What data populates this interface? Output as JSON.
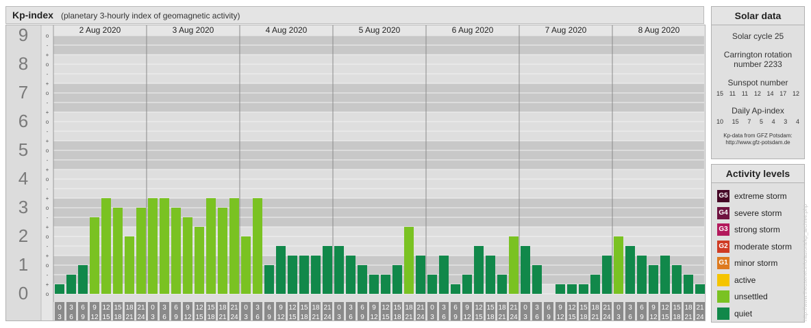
{
  "header": {
    "title": "Kp-index",
    "subtitle": "(planetary 3-hourly index of geomagnetic activity)"
  },
  "colors": {
    "quiet": "#11884a",
    "unsettled": "#7ac222",
    "active": "#f5c400",
    "minor_storm": "#de7a1f",
    "moderate_storm": "#cf3b24",
    "strong_storm": "#b3195c",
    "severe_storm": "#6f1240",
    "extreme_storm": "#450626"
  },
  "chart_data": {
    "type": "bar",
    "title": "Kp-index",
    "ylim": [
      0,
      9
    ],
    "y_ticks": [
      "0",
      "1",
      "2",
      "3",
      "4",
      "5",
      "6",
      "7",
      "8",
      "9"
    ],
    "sub_ticks": [
      "o",
      "+",
      "-"
    ],
    "days": [
      "2 Aug 2020",
      "3 Aug 2020",
      "4 Aug 2020",
      "5 Aug 2020",
      "6 Aug 2020",
      "7 Aug 2020",
      "8 Aug 2020"
    ],
    "interval_starts": [
      "0",
      "3",
      "6",
      "9",
      "12",
      "15",
      "18",
      "21"
    ],
    "interval_ends": [
      "3",
      "6",
      "9",
      "12",
      "15",
      "18",
      "21",
      "24"
    ],
    "values": [
      0.333,
      0.667,
      1.0,
      2.667,
      3.333,
      3.0,
      2.0,
      3.0,
      3.333,
      3.333,
      3.0,
      2.667,
      2.333,
      3.333,
      3.0,
      3.333,
      2.0,
      3.333,
      1.0,
      1.667,
      1.333,
      1.333,
      1.333,
      1.667,
      1.667,
      1.333,
      1.0,
      0.667,
      0.667,
      1.0,
      2.333,
      1.333,
      0.667,
      1.333,
      0.333,
      0.667,
      1.667,
      1.333,
      0.667,
      2.0,
      1.667,
      1.0,
      0.0,
      0.333,
      0.333,
      0.333,
      0.667,
      1.333,
      2.0,
      1.667,
      1.333,
      1.0,
      1.333,
      1.0,
      0.667,
      0.333
    ]
  },
  "solar": {
    "heading": "Solar data",
    "cycle": "Solar cycle 25",
    "carrington_line1": "Carrington rotation",
    "carrington_line2": "number 2233",
    "sunspot_heading": "Sunspot number",
    "sunspot_values": [
      "15",
      "11",
      "11",
      "12",
      "14",
      "17",
      "12"
    ],
    "ap_heading": "Daily Ap-index",
    "ap_values": [
      "10",
      "15",
      "7",
      "5",
      "4",
      "3",
      "4"
    ],
    "credit_line1": "Kp-data from GFZ Potsdam:",
    "credit_line2": "http://www.gfz-potsdam.de"
  },
  "activity": {
    "heading": "Activity levels",
    "levels": [
      {
        "code": "G5",
        "label": "extreme storm",
        "color": "#450626"
      },
      {
        "code": "G4",
        "label": "severe storm",
        "color": "#6f1240"
      },
      {
        "code": "G3",
        "label": "strong storm",
        "color": "#b3195c"
      },
      {
        "code": "G2",
        "label": "moderate storm",
        "color": "#cf3b24"
      },
      {
        "code": "G1",
        "label": "minor storm",
        "color": "#de7a1f"
      },
      {
        "code": "",
        "label": "active",
        "color": "#f5c400"
      },
      {
        "code": "",
        "label": "unsettled",
        "color": "#7ac222"
      },
      {
        "code": "",
        "label": "quiet",
        "color": "#11884a"
      }
    ]
  },
  "watermark": "http://www.theusenet.info/aurora/kp_archive.php"
}
